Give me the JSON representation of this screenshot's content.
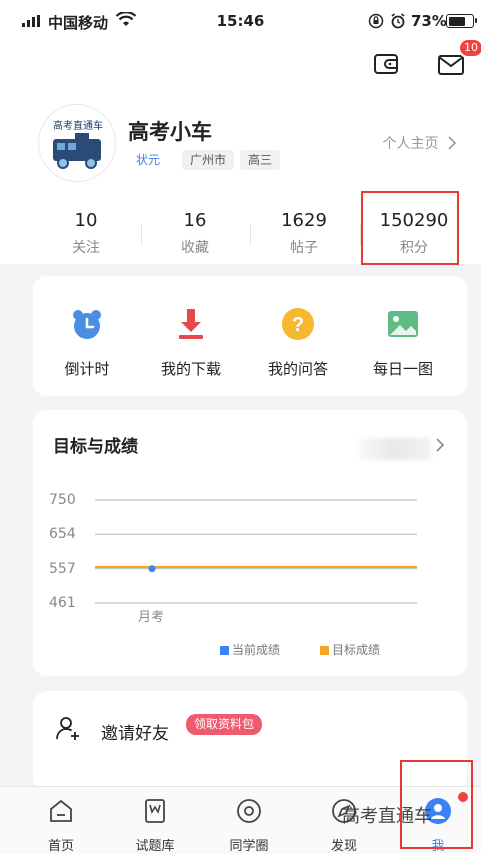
{
  "status_bar": {
    "carrier": "中国移动",
    "time": "15:46",
    "battery": "73%",
    "battery_level": 0.73
  },
  "header": {
    "message_badge": "10"
  },
  "profile": {
    "avatar_text": "高考直通车",
    "name": "高考小车",
    "tags": [
      "状元",
      "广州市",
      "高三"
    ],
    "homepage_link": "个人主页",
    "stats": [
      {
        "value": "10",
        "label": "关注"
      },
      {
        "value": "16",
        "label": "收藏"
      },
      {
        "value": "1629",
        "label": "帖子"
      },
      {
        "value": "150290",
        "label": "积分"
      }
    ]
  },
  "menu": [
    {
      "label": "倒计时",
      "icon": "alarm-clock-icon"
    },
    {
      "label": "我的下载",
      "icon": "download-icon"
    },
    {
      "label": "我的问答",
      "icon": "question-icon"
    },
    {
      "label": "每日一图",
      "icon": "image-icon"
    }
  ],
  "goals": {
    "title": "目标与成绩"
  },
  "chart_data": {
    "type": "line",
    "categories": [
      "月考"
    ],
    "ylim": [
      461,
      750
    ],
    "yticks": [
      "750",
      "654",
      "557",
      "461"
    ],
    "series": [
      {
        "name": "当前成绩",
        "values": [
          557
        ],
        "color": "#3b82f6"
      },
      {
        "name": "目标成绩",
        "values": [
          562
        ],
        "color": "#f5a623"
      }
    ],
    "legend": "bottom-right",
    "grid": true
  },
  "invite": {
    "label": "邀请好友",
    "pill": "领取资料包"
  },
  "tabbar": {
    "items": [
      {
        "label": "首页",
        "icon": "home-icon"
      },
      {
        "label": "试题库",
        "icon": "question-bank-icon"
      },
      {
        "label": "同学圈",
        "icon": "circle-icon"
      },
      {
        "label": "发现",
        "icon": "discover-icon"
      },
      {
        "label": "我",
        "icon": "me-icon"
      }
    ]
  },
  "watermark": "高考直通车",
  "colors": {
    "accent": "#3b82f6",
    "highlight_border": "#e53935",
    "badge": "#ef4444",
    "pill": "#ef5a6f",
    "target_line": "#f5a623"
  }
}
